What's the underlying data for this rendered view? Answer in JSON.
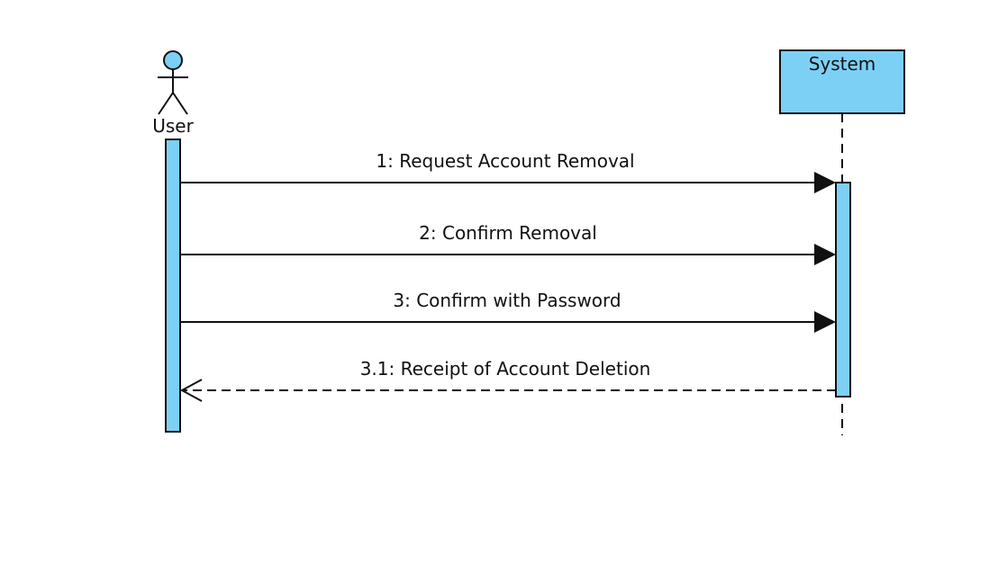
{
  "actor": {
    "label": "User"
  },
  "lifeline": {
    "label": "System"
  },
  "messages": [
    {
      "label": "1: Request Account Removal",
      "kind": "sync"
    },
    {
      "label": "2: Confirm Removal",
      "kind": "sync"
    },
    {
      "label": "3: Confirm with Password",
      "kind": "sync"
    },
    {
      "label": "3.1: Receipt of Account Deletion",
      "kind": "return"
    }
  ],
  "colors": {
    "fill": "#7dd0f5",
    "stroke": "#111111",
    "background": "#ffffff"
  }
}
